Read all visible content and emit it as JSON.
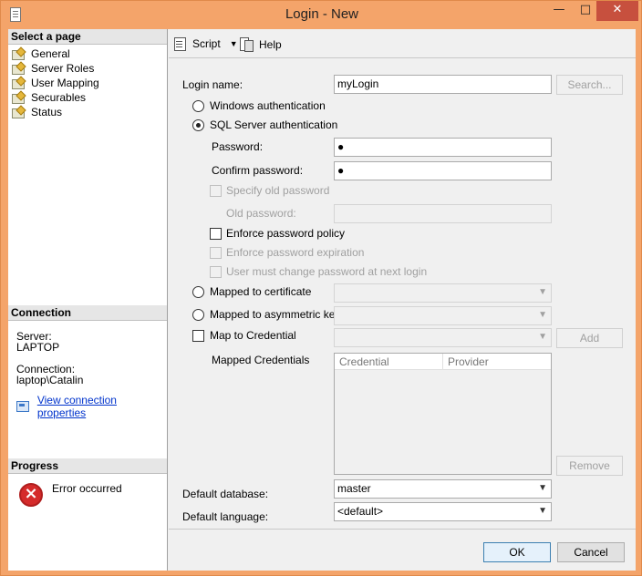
{
  "window": {
    "title": "Login - New",
    "min_glyph": "—",
    "max_glyph": "□",
    "close_glyph": "✕"
  },
  "left": {
    "select_page_header": "Select a page",
    "pages": [
      "General",
      "Server Roles",
      "User Mapping",
      "Securables",
      "Status"
    ],
    "selected_page": "General",
    "connection_header": "Connection",
    "server_label": "Server:",
    "server_value": "LAPTOP",
    "connection_label": "Connection:",
    "connection_value": "laptop\\Catalin",
    "view_props_link": "View connection properties",
    "progress_header": "Progress",
    "progress_status": "Error occurred"
  },
  "toolbar": {
    "script_label": "Script",
    "help_label": "Help"
  },
  "form": {
    "login_name_label": "Login name:",
    "login_name_value": "myLogin",
    "search_button": "Search...",
    "windows_auth": "Windows authentication",
    "sql_auth": "SQL Server authentication",
    "auth_selected": "sql",
    "password_label": "Password:",
    "password_value": "●",
    "confirm_label": "Confirm password:",
    "confirm_value": "●",
    "specify_old": "Specify old password",
    "old_password_label": "Old password:",
    "enforce_policy": "Enforce password policy",
    "enforce_policy_checked": false,
    "enforce_expiration": "Enforce password expiration",
    "must_change": "User must change password at next login",
    "mapped_cert": "Mapped to certificate",
    "mapped_asym": "Mapped to asymmetric key",
    "map_credential": "Map to Credential",
    "add_button": "Add",
    "mapped_credentials_label": "Mapped Credentials",
    "credentials_columns": [
      "Credential",
      "Provider"
    ],
    "remove_button": "Remove",
    "default_db_label": "Default database:",
    "default_db_value": "master",
    "default_lang_label": "Default language:",
    "default_lang_value": "<default>"
  },
  "buttons": {
    "ok": "OK",
    "cancel": "Cancel"
  }
}
